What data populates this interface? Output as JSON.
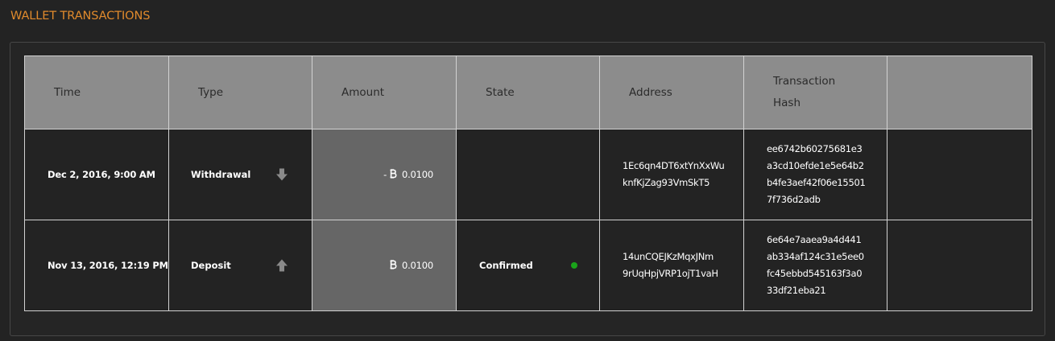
{
  "section": {
    "title": "WALLET TRANSACTIONS"
  },
  "table": {
    "headers": {
      "time": "Time",
      "type": "Type",
      "amount": "Amount",
      "state": "State",
      "address": "Address",
      "hash_line1": "Transaction",
      "hash_line2": "Hash",
      "extra": ""
    },
    "rows": [
      {
        "time": "Dec 2, 2016, 9:00 AM",
        "type": "Withdrawal",
        "type_icon": "arrow-down-icon",
        "amount_sign": "-",
        "amount": "0.0100",
        "state": "",
        "address_line1": "1Ec6qn4DT6xtYnXxWu",
        "address_line2": "knfKjZag93VmSkT5",
        "hash_line1": "ee6742b60275681e3",
        "hash_line2": "a3cd10efde1e5e64b2",
        "hash_line3": "b4fe3aef42f06e15501",
        "hash_line4": "7f736d2adb"
      },
      {
        "time": "Nov 13, 2016, 12:19 PM",
        "type": "Deposit",
        "type_icon": "arrow-up-icon",
        "amount_sign": "",
        "amount": "0.0100",
        "state": "Confirmed",
        "state_color": "#1aa31a",
        "address_line1": "14unCQEJKzMqxJNm",
        "address_line2": "9rUqHpjVRP1ojT1vaH",
        "hash_line1": "6e64e7aaea9a4d441",
        "hash_line2": "ab334af124c31e5ee0",
        "hash_line3": "fc45ebbd545163f3a0",
        "hash_line4": "33df21eba21"
      }
    ]
  },
  "colors": {
    "title": "#e08a2c",
    "header_bg": "#8c8c8c",
    "amount_bg": "#666666",
    "confirmed": "#1aa31a"
  }
}
